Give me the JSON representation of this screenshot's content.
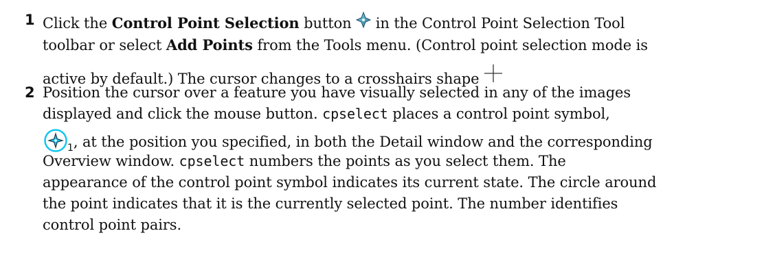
{
  "step1": {
    "number": "1",
    "l1_a": "Click the ",
    "l1_b": "Control Point Selection",
    "l1_c": " button ",
    "l1_d": " in the Control Point Selection Tool",
    "l2_a": "toolbar or select ",
    "l2_b": "Add Points",
    "l2_c": " from the Tools menu. (Control point selection mode is",
    "l3_a": "active by default.) The cursor changes to a crosshairs shape ",
    "icons": {
      "button": "control-point-selection-icon",
      "cursor": "crosshair-icon"
    }
  },
  "step2": {
    "number": "2",
    "l1": "Position the cursor over a feature you have visually selected in any of the images",
    "l2_a": "displayed and click the mouse button. ",
    "l2_code": "cpselect",
    "l2_b": " places a control point symbol,",
    "symbol_number": "1",
    "l3_a": ", at the position you specified, in both the Detail window and the corresponding",
    "l4_a": "Overview window. ",
    "l4_code": "cpselect",
    "l4_b": " numbers the points as you select them. The",
    "l5": "appearance of the control point symbol indicates its current state. The circle around",
    "l6": "the point indicates that it is the currently selected point. The number identifies",
    "l7": "control point pairs.",
    "icons": {
      "symbol": "control-point-symbol-icon"
    }
  }
}
